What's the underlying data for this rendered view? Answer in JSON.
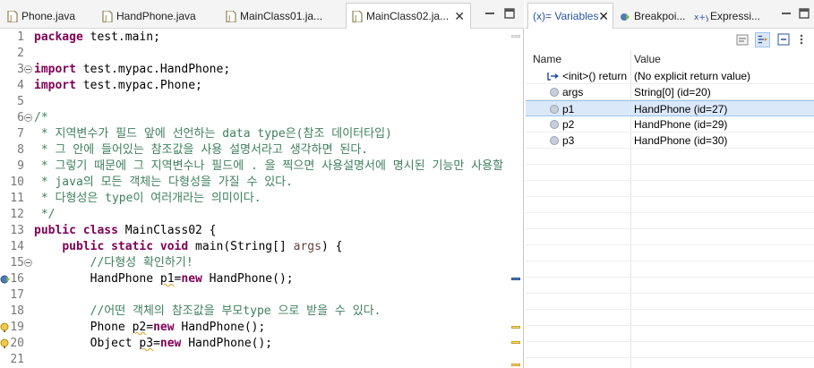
{
  "editor": {
    "tabs": [
      {
        "label": "Phone.java",
        "active": false
      },
      {
        "label": "HandPhone.java",
        "active": false
      },
      {
        "label": "MainClass01.ja...",
        "active": false
      },
      {
        "label": "MainClass02.ja...",
        "active": true
      }
    ],
    "close_glyph": "✕",
    "lines": [
      {
        "n": "1",
        "text": "package test.main;"
      },
      {
        "n": "2",
        "text": ""
      },
      {
        "n": "3",
        "text": "import test.mypac.HandPhone;"
      },
      {
        "n": "4",
        "text": "import test.mypac.Phone;"
      },
      {
        "n": "5",
        "text": ""
      },
      {
        "n": "6",
        "text": "/*"
      },
      {
        "n": "7",
        "text": " * 지역변수가 필드 앞에 선언하는 data type은(참조 데이터타입)"
      },
      {
        "n": "8",
        "text": " * 그 안에 들어있는 참조값을 사용 설명서라고 생각하면 된다."
      },
      {
        "n": "9",
        "text": " * 그렇기 때문에 그 지역변수나 필드에 . 을 찍으면 사용설명서에 명시된 기능만 사용할 수"
      },
      {
        "n": "10",
        "text": " * java의 모든 객체는 다형성을 가질 수 있다."
      },
      {
        "n": "11",
        "text": " * 다형성은 type이 여러개라는 의미이다."
      },
      {
        "n": "12",
        "text": " */"
      },
      {
        "n": "13",
        "text": "public class MainClass02 {"
      },
      {
        "n": "14",
        "text": "    public static void main(String[] args) {"
      },
      {
        "n": "15",
        "text": "        //다형성 확인하기!"
      },
      {
        "n": "16",
        "text": "        HandPhone p1=new HandPhone();"
      },
      {
        "n": "17",
        "text": ""
      },
      {
        "n": "18",
        "text": "        //어떤 객체의 참조값을 부모type 으로 받을 수 있다."
      },
      {
        "n": "19",
        "text": "        Phone p2=new HandPhone();"
      },
      {
        "n": "20",
        "text": "        Object p3=new HandPhone();"
      },
      {
        "n": "21",
        "text": ""
      }
    ],
    "code": {
      "l1_kw": "package",
      "l1_rest": " test.main;",
      "l3_kw": "import",
      "l3_rest": " test.mypac.HandPhone;",
      "l4_kw": "import",
      "l4_rest": " test.mypac.Phone;",
      "l13_kw1": "public",
      "l13_kw2": "class",
      "l13_rest": " MainClass02 {",
      "l14_indent": "    ",
      "l14_kw1": "public",
      "l14_kw2": "static",
      "l14_kw3": "void",
      "l14_mid": " main(String[] ",
      "l14_param": "args",
      "l14_end": ") {",
      "l16_a": "        HandPhone ",
      "l16_var": "p1",
      "l16_b": "=",
      "l16_kw": "new",
      "l16_c": " HandPhone();",
      "l19_a": "        Phone ",
      "l19_var": "p2",
      "l19_b": "=",
      "l19_kw": "new",
      "l19_c": " HandPhone();",
      "l20_a": "        Object ",
      "l20_var": "p3",
      "l20_b": "=",
      "l20_kw": "new",
      "l20_c": " HandPhone();"
    }
  },
  "variables_view": {
    "tabs": [
      {
        "label": "(x)= Variables",
        "active": true
      },
      {
        "label": "Breakpoi...",
        "active": false
      },
      {
        "label": "Expressi...",
        "active": false
      }
    ],
    "columns": {
      "name": "Name",
      "value": "Value"
    },
    "rows": [
      {
        "name": "<init>() return",
        "value": "(No explicit return value)",
        "icon": "return-arrow-icon",
        "selected": false
      },
      {
        "name": "args",
        "value": "String[0]  (id=20)",
        "icon": "local-variable-icon",
        "selected": false
      },
      {
        "name": "p1",
        "value": "HandPhone  (id=27)",
        "icon": "local-variable-icon",
        "selected": true
      },
      {
        "name": "p2",
        "value": "HandPhone  (id=29)",
        "icon": "local-variable-icon",
        "selected": false
      },
      {
        "name": "p3",
        "value": "HandPhone  (id=30)",
        "icon": "local-variable-icon",
        "selected": false
      }
    ]
  },
  "colors": {
    "keyword": "#7f0055",
    "comment": "#3f7f5f",
    "selection": "#dbe8fa",
    "line_number": "#787878"
  }
}
